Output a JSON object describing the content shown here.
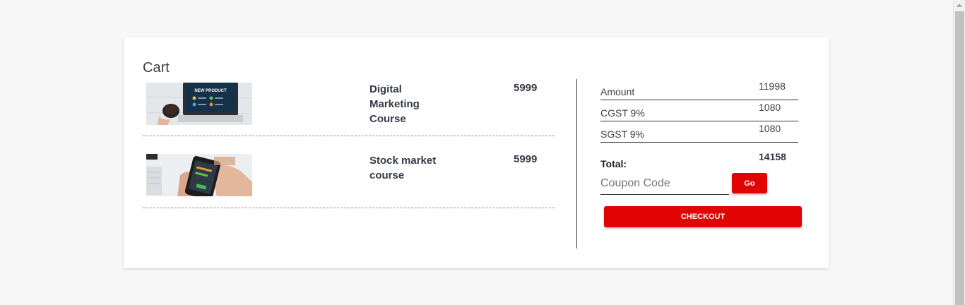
{
  "cart": {
    "title": "Cart",
    "items": [
      {
        "name": "Digital Marketing Course",
        "price": "5999",
        "image": "laptop-new-product-image"
      },
      {
        "name": "Stock market course",
        "price": "5999",
        "image": "smartphone-trading-image"
      }
    ]
  },
  "summary": {
    "rows": [
      {
        "label": "Amount",
        "value": "11998"
      },
      {
        "label": "CGST 9%",
        "value": "1080"
      },
      {
        "label": "SGST 9%",
        "value": "1080"
      }
    ],
    "total_label": "Total:",
    "total_value": "14158"
  },
  "coupon": {
    "placeholder": "Coupon Code",
    "value": "",
    "go_label": "Go"
  },
  "checkout_label": "CHECKOUT",
  "images": {
    "laptop_screen_text": "NEW PRODUCT"
  },
  "colors": {
    "accent": "#e00404",
    "page_bg": "#f7f7f7",
    "card_bg": "#ffffff",
    "text": "#333a45"
  }
}
